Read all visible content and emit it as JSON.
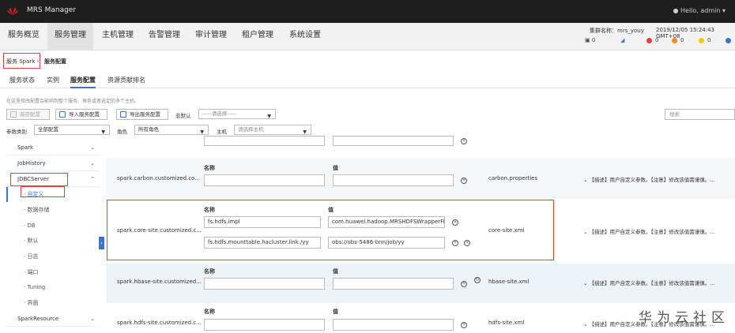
{
  "header": {
    "app_title": "MRS Manager",
    "user": "Hello, admin ▾",
    "cluster_label": "集群名称：mrs_youy",
    "datetime": "2019/12/05 15:24:43 GMT+08"
  },
  "nav": [
    "服务概览",
    "服务管理",
    "主机管理",
    "告警管理",
    "审计管理",
    "租户管理",
    "系统设置"
  ],
  "stats": {
    "tasks": "0",
    "a": "0",
    "b": "0",
    "c": "0",
    "d": "0"
  },
  "breadcrumb": {
    "service": "服务 Spark",
    "sep": "›",
    "current": "服务配置"
  },
  "subtabs": [
    "服务状态",
    "实例",
    "服务配置",
    "资源贡献排名"
  ],
  "hint": "在这里修改配置会影响到整个服务、角色或者选定的多个主机。",
  "toolbar": {
    "save": "保存配置",
    "import": "导入服务配置",
    "export": "导出服务配置",
    "non_default": "非默认",
    "non_default_select": "-----请选择-----",
    "search": "搜索"
  },
  "filter": {
    "param_type": "参数类别",
    "param_value": "全部配置",
    "role": "角色",
    "role_value": "所有角色",
    "host": "主机",
    "host_placeholder": "请选择主机"
  },
  "sidebar": {
    "items": [
      "Spark",
      "JobHistory",
      "JDBCServer"
    ],
    "sub": [
      "自定义",
      "数据存储",
      "DB",
      "默认",
      "日志",
      "端口",
      "Tuning",
      "界面"
    ],
    "bottom": "SparkResource"
  },
  "rows": [
    {
      "name": "spark.carbon.customized.co...",
      "hdr_name": "名称",
      "hdr_value": "值",
      "file": "carbon.properties",
      "desc": "【描述】用户自定义参数。【注意】修改该值需谨慎。..."
    },
    {
      "name": "spark.core-site.customized.c...",
      "hdr_name": "名称",
      "hdr_value": "值",
      "k1": "fs.hdfs.impl",
      "v1": "com.huawei.hadoop.MRSHDFSWrapperFi",
      "k2": "fs.hdfs.mounttable.hacluster.link./yy",
      "v2": "obs://obs-5486-bnn/job/yy",
      "file": "core-site.xml",
      "desc": "【描述】用户自定义参数。【注意】修改该值需谨慎。..."
    },
    {
      "name": "spark.hbase-site.customized...",
      "hdr_name": "名称",
      "hdr_value": "值",
      "file": "hbase-site.xml",
      "desc": "【描述】用户自定义参数。【注意】修改该值需谨慎。..."
    },
    {
      "name": "spark.hdfs-site.customized.c...",
      "hdr_name": "名称",
      "hdr_value": "值",
      "file": "hdfs-site.xml",
      "desc": "【描述】用户自定义参数。【注意】修改该值需谨慎。..."
    }
  ],
  "watermark": "华为云社区",
  "colors": {
    "accent": "#3a75c4",
    "highlight": "#e04040",
    "topbar": "#1e1e1e"
  }
}
